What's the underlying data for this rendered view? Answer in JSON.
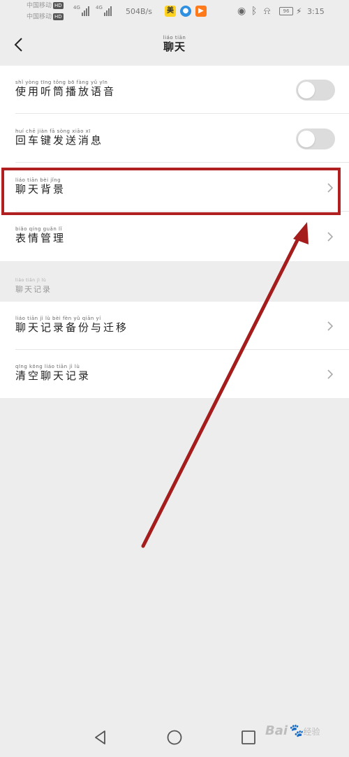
{
  "status_bar": {
    "carrier_line1": "中国移动",
    "carrier_line2": "中国移动",
    "hd": "HD",
    "net_type": "4G",
    "net_speed": "504B/s",
    "app1": "美",
    "battery": "96",
    "time": "3:15"
  },
  "header": {
    "title_pinyin": "liáo tiān",
    "title": "聊天"
  },
  "settings": [
    {
      "pinyin": "shǐ yòng tīng tǒng bō fàng yǔ yīn",
      "label": "使用听筒播放语音",
      "control": "toggle",
      "on": false
    },
    {
      "pinyin": "huí chē jiàn fā sòng xiāo xī",
      "label": "回车键发送消息",
      "control": "toggle",
      "on": false
    },
    {
      "pinyin": "liáo tiān bèi jǐng",
      "label": "聊天背景",
      "control": "chevron"
    },
    {
      "pinyin": "biǎo qíng guǎn lǐ",
      "label": "表情管理",
      "control": "chevron"
    }
  ],
  "section": {
    "pinyin": "liáo tiān jì lù",
    "label": "聊天记录"
  },
  "records": [
    {
      "pinyin": "liáo tiān jì lù bèi fèn yǔ qiān yí",
      "label": "聊天记录备份与迁移",
      "control": "chevron"
    },
    {
      "pinyin": "qīng kōng liáo tiān jì lù",
      "label": "清空聊天记录",
      "control": "chevron"
    }
  ],
  "watermark": {
    "text": "Bai",
    "suffix": "经验"
  },
  "colors": {
    "highlight": "#b02020",
    "arrow": "#a51c1c",
    "background": "#ededed",
    "toggle_off": "#dcdcdc"
  }
}
